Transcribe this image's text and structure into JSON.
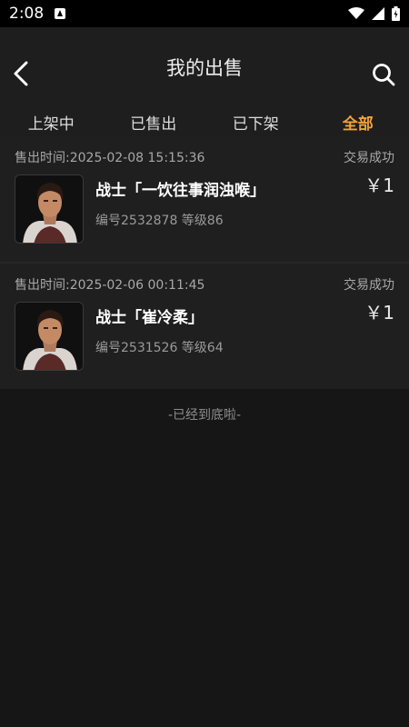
{
  "status_bar": {
    "time": "2:08"
  },
  "header": {
    "title": "我的出售"
  },
  "tabs": [
    {
      "label": "上架中",
      "active": false
    },
    {
      "label": "已售出",
      "active": false
    },
    {
      "label": "已下架",
      "active": false
    },
    {
      "label": "全部",
      "active": true
    }
  ],
  "orders": [
    {
      "time": "售出时间:2025-02-08 15:15:36",
      "status": "交易成功",
      "name": "战士「一饮往事润浊喉」",
      "meta": "编号2532878 等级86",
      "price": "￥1"
    },
    {
      "time": "售出时间:2025-02-06 00:11:45",
      "status": "交易成功",
      "name": "战士「崔冷柔」",
      "meta": "编号2531526 等级64",
      "price": "￥1"
    }
  ],
  "end_note": "-已经到底啦-",
  "colors": {
    "accent": "#f2a23a",
    "background": "#161616",
    "card": "#1f1f1f"
  },
  "icons": [
    "back-arrow-icon",
    "search-icon",
    "wifi-icon",
    "signal-icon",
    "battery-icon"
  ]
}
